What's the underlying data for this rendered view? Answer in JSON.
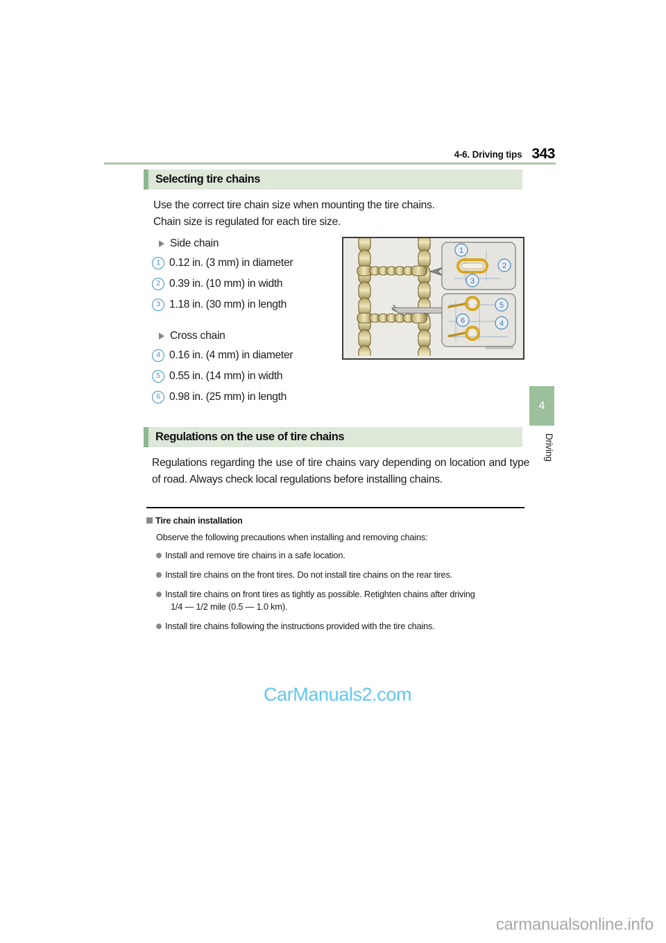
{
  "header": {
    "section_title": "4-6. Driving tips",
    "page_number": "343"
  },
  "sections": [
    {
      "heading": "Selecting tire chains",
      "paragraphs": [
        "Use the correct tire chain size when mounting the tire chains.",
        "Chain size is regulated for each tire size."
      ]
    },
    {
      "heading": "Regulations on the use of tire chains",
      "paragraphs": [
        "Regulations regarding the use of tire chains vary depending on location and type of road. Always check local regulations before installing chains."
      ]
    }
  ],
  "specs": {
    "side_chain_label": "Side chain",
    "cross_chain_label": "Cross chain",
    "side_chain_items": [
      {
        "num": "1",
        "text": "0.12 in. (3 mm) in diameter"
      },
      {
        "num": "2",
        "text": "0.39 in. (10 mm) in width"
      },
      {
        "num": "3",
        "text": "1.18 in. (30 mm) in length"
      }
    ],
    "cross_chain_items": [
      {
        "num": "4",
        "text": "0.16 in. (4 mm) in diameter"
      },
      {
        "num": "5",
        "text": "0.55 in. (14 mm) in width"
      },
      {
        "num": "6",
        "text": "0.98 in. (25 mm) in length"
      }
    ]
  },
  "illustration": {
    "callout_numbers": [
      "1",
      "2",
      "3",
      "4",
      "5",
      "6"
    ]
  },
  "side_tab": {
    "chapter_number": "4",
    "chapter_label": "Driving"
  },
  "notes": {
    "title": "Tire chain installation",
    "intro": "Observe the following precautions when installing and removing chains:",
    "bullets": [
      {
        "text": "Install and remove tire chains in a safe location.",
        "sub": ""
      },
      {
        "text": "Install tire chains on the front tires. Do not install tire chains on the rear tires.",
        "sub": ""
      },
      {
        "text": "Install tire chains on front tires as tightly as possible. Retighten chains after driving",
        "sub": "1/4 — 1/2 mile (0.5 — 1.0 km)."
      },
      {
        "text": "Install tire chains following the instructions provided with the tire chains.",
        "sub": ""
      }
    ]
  },
  "watermarks": {
    "center": "CarManuals2.com",
    "footer": "carmanualsonline.info"
  },
  "colors": {
    "heading_bar_fill": "#dde8d9",
    "heading_bar_accent": "#8fb78f",
    "header_rule": "#a9c8a9",
    "side_tab": "#9cc09c",
    "number_circle": "#3f8fc9",
    "bullet_gray": "#8a8a8a",
    "watermark_blue": "#5ec8f0"
  }
}
